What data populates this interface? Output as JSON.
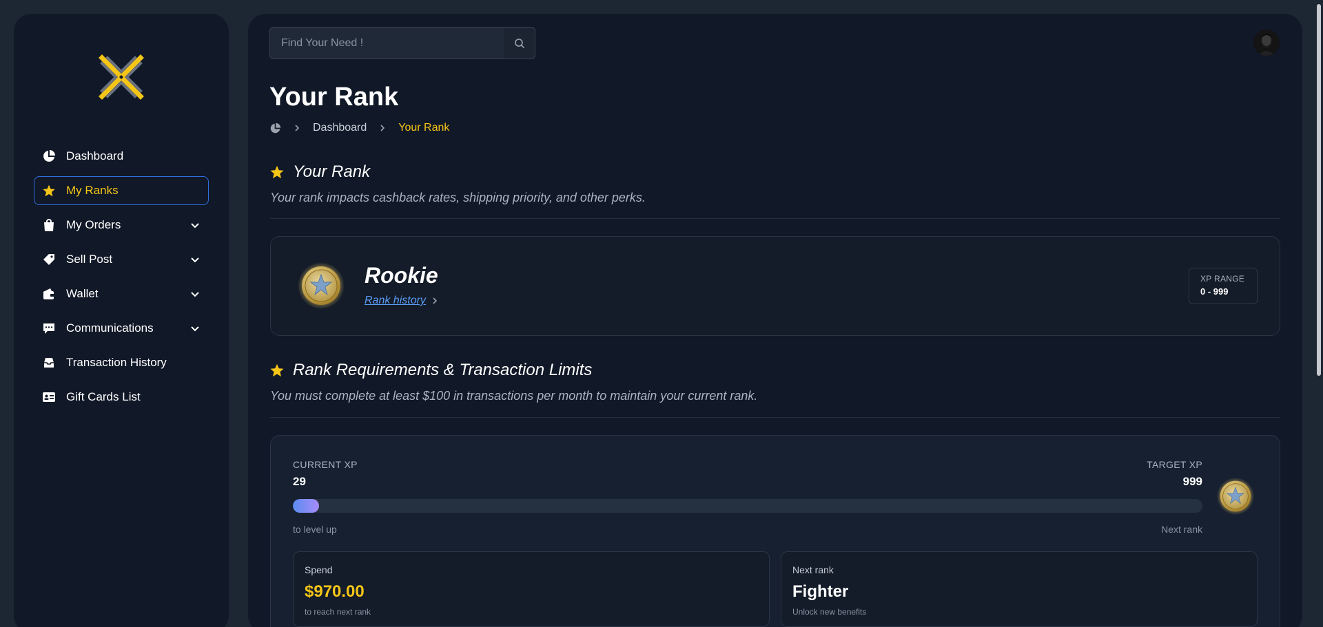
{
  "sidebar": {
    "items": [
      {
        "label": "Dashboard",
        "icon": "pie-chart-icon",
        "active": false,
        "has_chevron": false
      },
      {
        "label": "My Ranks",
        "icon": "star-icon",
        "active": true,
        "has_chevron": false
      },
      {
        "label": "My Orders",
        "icon": "shopping-bag-icon",
        "active": false,
        "has_chevron": true
      },
      {
        "label": "Sell Post",
        "icon": "tag-icon",
        "active": false,
        "has_chevron": true
      },
      {
        "label": "Wallet",
        "icon": "wallet-icon",
        "active": false,
        "has_chevron": true
      },
      {
        "label": "Communications",
        "icon": "chat-icon",
        "active": false,
        "has_chevron": true
      },
      {
        "label": "Transaction History",
        "icon": "inbox-icon",
        "active": false,
        "has_chevron": false
      },
      {
        "label": "Gift Cards List",
        "icon": "id-card-icon",
        "active": false,
        "has_chevron": false
      }
    ]
  },
  "search": {
    "placeholder": "Find Your Need !",
    "value": ""
  },
  "page": {
    "title": "Your Rank",
    "breadcrumb": {
      "home_icon": "pie-chart-icon",
      "parent": "Dashboard",
      "current": "Your Rank"
    }
  },
  "rank_section": {
    "title": "Your Rank",
    "description": "Your rank impacts cashback rates, shipping priority, and other perks.",
    "rank_name": "Rookie",
    "history_link": "Rank history",
    "xp_range_label": "XP RANGE",
    "xp_range_value": "0 - 999"
  },
  "requirements_section": {
    "title": "Rank Requirements & Transaction Limits",
    "description": "You must complete at least $100 in transactions per month to maintain your current rank."
  },
  "xp": {
    "current_label": "CURRENT XP",
    "current_value": "29",
    "target_label": "TARGET XP",
    "target_value": "999",
    "progress_percent": 2.9,
    "left_footer": "to level up",
    "right_footer": "Next rank"
  },
  "stats": {
    "spend": {
      "label": "Spend",
      "value": "$970.00",
      "sub": "to reach next rank"
    },
    "next_rank": {
      "label": "Next rank",
      "value": "Fighter",
      "sub": "Unlock new benefits"
    }
  },
  "colors": {
    "accent": "#f5c518",
    "link": "#5b9cf5",
    "active_border": "#2f6fe0",
    "background": "#111827"
  }
}
